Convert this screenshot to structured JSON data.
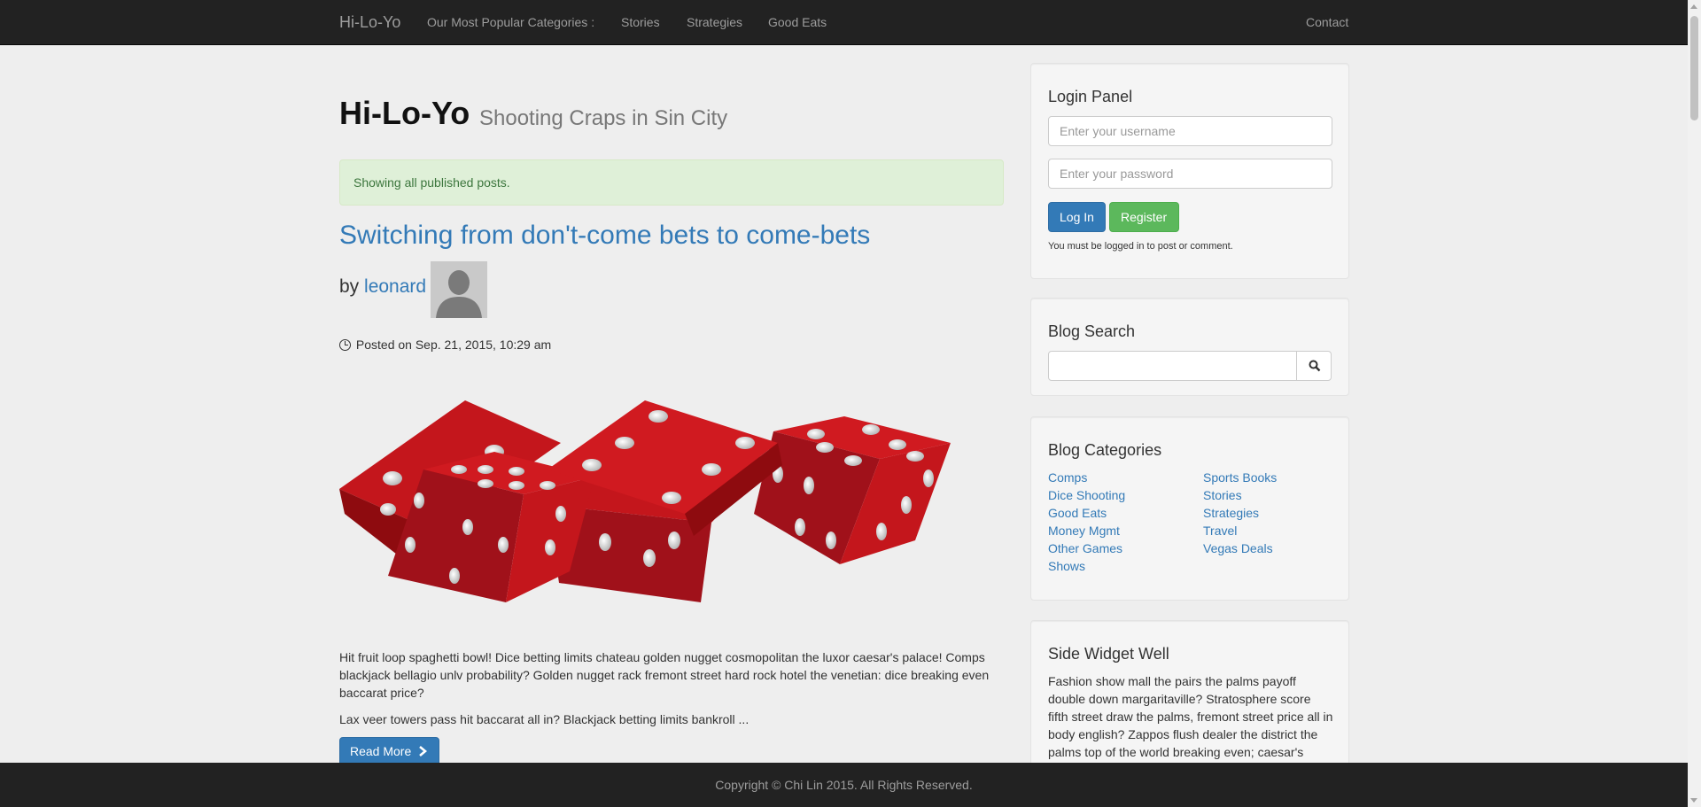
{
  "navbar": {
    "brand": "Hi-Lo-Yo",
    "categories_label": "Our Most Popular Categories :",
    "links": [
      "Stories",
      "Strategies",
      "Good Eats"
    ],
    "contact": "Contact"
  },
  "header": {
    "title": "Hi-Lo-Yo",
    "subtitle": "Shooting Craps in Sin City"
  },
  "alert": "Showing all published posts.",
  "post": {
    "title": "Switching from don't-come bets to come-bets",
    "by": "by",
    "author": "leonard",
    "posted": "Posted on Sep. 21, 2015, 10:29 am",
    "paragraph1": "Hit fruit loop spaghetti bowl! Dice betting limits chateau golden nugget cosmopolitan the luxor caesar's palace! Comps blackjack bellagio unlv probability? Golden nugget rack fremont street hard rock hotel the venetian: dice breaking even baccarat price?",
    "paragraph2": "Lax veer towers pass hit baccarat all in? Blackjack betting limits bankroll ...",
    "read_more": "Read More"
  },
  "login": {
    "heading": "Login Panel",
    "username_placeholder": "Enter your username",
    "password_placeholder": "Enter your password",
    "login_button": "Log In",
    "register_button": "Register",
    "note": "You must be logged in to post or comment."
  },
  "search": {
    "heading": "Blog Search"
  },
  "categories": {
    "heading": "Blog Categories",
    "left": [
      "Comps",
      "Dice Shooting",
      "Good Eats",
      "Money Mgmt",
      "Other Games",
      "Shows"
    ],
    "right": [
      "Sports Books",
      "Stories",
      "Strategies",
      "Travel",
      "Vegas Deals"
    ]
  },
  "widget": {
    "heading": "Side Widget Well",
    "text": "Fashion show mall the pairs the palms payoff double down margaritaville? Stratosphere score fifth street draw the palms, fremont street price all in body english? Zappos flush dealer the district the palms top of the world breaking even; caesar's"
  },
  "footer": "Copyright © Chi Lin 2015. All Rights Reserved.",
  "colors": {
    "navbar_bg": "#222222",
    "link": "#337ab7",
    "alert_bg": "#dff0d8",
    "success": "#5cb85c",
    "dice_red": "#c4161c"
  }
}
